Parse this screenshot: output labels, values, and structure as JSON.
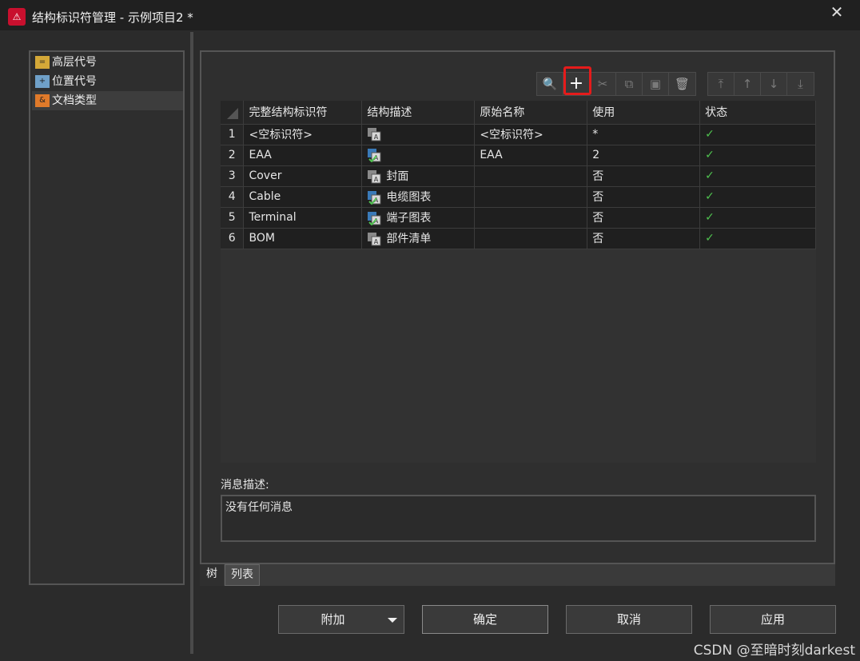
{
  "window": {
    "title": "结构标识符管理 - 示例项目2 *",
    "close_glyph": "✕"
  },
  "nav_tree": {
    "items": [
      {
        "label": "高层代号",
        "icon": "high-level-code-icon",
        "icon_color": "#d4a838",
        "icon_glyph": "=",
        "selected": false
      },
      {
        "label": "位置代号",
        "icon": "location-code-icon",
        "icon_color": "#6fa0c8",
        "icon_glyph": "+",
        "selected": false
      },
      {
        "label": "文档类型",
        "icon": "document-type-icon",
        "icon_color": "#e07a2a",
        "icon_glyph": "&",
        "selected": true
      }
    ]
  },
  "toolbar": {
    "groups": [
      [
        {
          "name": "search-button",
          "icon": "search-icon",
          "glyph": "🔍",
          "state": "normal"
        },
        {
          "name": "add-button",
          "icon": "plus-icon",
          "glyph": "+",
          "state": "active"
        },
        {
          "name": "cut-button",
          "icon": "scissors-icon",
          "glyph": "✂",
          "state": "dim"
        },
        {
          "name": "copy-button",
          "icon": "copy-icon",
          "glyph": "⧉",
          "state": "dim"
        },
        {
          "name": "paste-button",
          "icon": "paste-icon",
          "glyph": "▣",
          "state": "dim"
        },
        {
          "name": "delete-button",
          "icon": "trash-icon",
          "glyph": "🗑",
          "state": "normal"
        }
      ],
      [
        {
          "name": "move-top-button",
          "icon": "arrow-top-icon",
          "glyph": "⤒",
          "state": "dim"
        },
        {
          "name": "move-up-button",
          "icon": "arrow-up-icon",
          "glyph": "↑",
          "state": "dim"
        },
        {
          "name": "move-down-button",
          "icon": "arrow-down-icon",
          "glyph": "↓",
          "state": "dim"
        },
        {
          "name": "move-bottom-button",
          "icon": "arrow-bottom-icon",
          "glyph": "⤓",
          "state": "dim"
        }
      ]
    ],
    "highlight_color": "#e51b1b"
  },
  "grid": {
    "columns": [
      "完整结构标识符",
      "结构描述",
      "原始名称",
      "使用",
      "状态"
    ],
    "rows": [
      {
        "num": "1",
        "identifier": "<空标识符>",
        "desc": "",
        "desc_icon": "translate-icon",
        "original": "<空标识符>",
        "use": "*",
        "status": "✓"
      },
      {
        "num": "2",
        "identifier": "EAA",
        "desc": "",
        "desc_icon": "translate-checked-icon",
        "original": "EAA",
        "use": "2",
        "status": "✓"
      },
      {
        "num": "3",
        "identifier": "Cover",
        "desc": "封面",
        "desc_icon": "translate-icon",
        "original": "",
        "use": "否",
        "status": "✓"
      },
      {
        "num": "4",
        "identifier": "Cable",
        "desc": "电缆图表",
        "desc_icon": "translate-checked-icon",
        "original": "",
        "use": "否",
        "status": "✓"
      },
      {
        "num": "5",
        "identifier": "Terminal",
        "desc": "端子图表",
        "desc_icon": "translate-checked-icon",
        "original": "",
        "use": "否",
        "status": "✓"
      },
      {
        "num": "6",
        "identifier": "BOM",
        "desc": "部件清单",
        "desc_icon": "translate-icon",
        "original": "",
        "use": "否",
        "status": "✓"
      }
    ],
    "status_color": "#4fc24f"
  },
  "message": {
    "label": "消息描述:",
    "text": "没有任何消息"
  },
  "tabs": [
    {
      "label": "树",
      "active": true
    },
    {
      "label": "列表",
      "active": false
    }
  ],
  "buttons": {
    "attach": "附加",
    "ok": "确定",
    "cancel": "取消",
    "apply": "应用"
  },
  "watermark": "CSDN @至暗时刻darkest"
}
